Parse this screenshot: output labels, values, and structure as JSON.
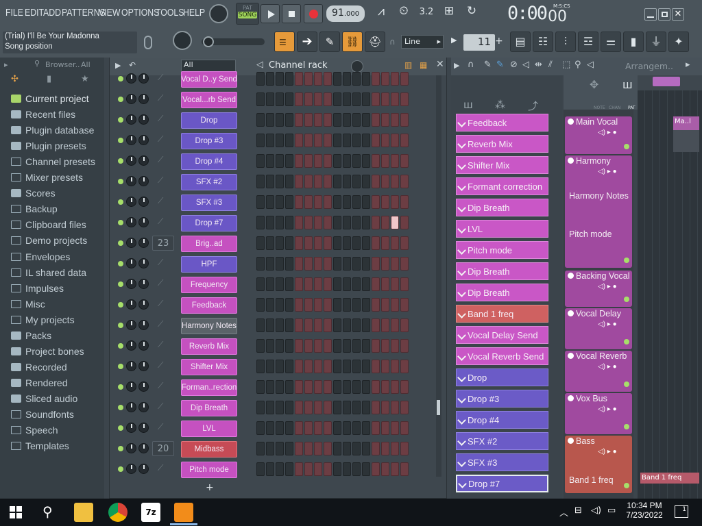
{
  "menu": [
    "FILE",
    "EDIT",
    "ADD",
    "PATTERNS",
    "VIEW",
    "OPTIONS",
    "TOOLS",
    "HELP"
  ],
  "transport": {
    "pat": "PAT",
    "song": "SONG",
    "tempo": "91",
    "tempo_dec": ".000",
    "time": "0:00",
    "time_cs": "00",
    "time_unit": "M:S:CS"
  },
  "hint": {
    "line1": "(Trial) I'll Be Your Madonna",
    "line2": "Song position"
  },
  "snap": "Line",
  "pattern": "11",
  "browser": {
    "title": "Browser..",
    "filter": "All",
    "items": [
      "Current project",
      "Recent files",
      "Plugin database",
      "Plugin presets",
      "Channel presets",
      "Mixer presets",
      "Scores",
      "Backup",
      "Clipboard files",
      "Demo projects",
      "Envelopes",
      "IL shared data",
      "Impulses",
      "Misc",
      "My projects",
      "Packs",
      "Project bones",
      "Recorded",
      "Rendered",
      "Sliced audio",
      "Soundfonts",
      "Speech",
      "Templates"
    ]
  },
  "rack": {
    "title": "Channel rack",
    "filter": "All",
    "channels": [
      {
        "name": "Vocal D..y Send",
        "color": "pink",
        "num": ""
      },
      {
        "name": "Vocal...rb Send",
        "color": "pink",
        "num": ""
      },
      {
        "name": "Drop",
        "color": "purple",
        "num": ""
      },
      {
        "name": "Drop #3",
        "color": "purple",
        "num": ""
      },
      {
        "name": "Drop #4",
        "color": "purple",
        "num": ""
      },
      {
        "name": "SFX #2",
        "color": "purple",
        "num": ""
      },
      {
        "name": "SFX #3",
        "color": "purple",
        "num": ""
      },
      {
        "name": "Drop #7",
        "color": "purple",
        "num": ""
      },
      {
        "name": "Brig..ad",
        "color": "pink",
        "num": "23"
      },
      {
        "name": "HPF",
        "color": "purple",
        "num": ""
      },
      {
        "name": "Frequency",
        "color": "pink",
        "num": ""
      },
      {
        "name": "Feedback",
        "color": "pink",
        "num": ""
      },
      {
        "name": "Harmony Notes",
        "color": "grey",
        "num": ""
      },
      {
        "name": "Reverb Mix",
        "color": "pink",
        "num": ""
      },
      {
        "name": "Shifter Mix",
        "color": "pink",
        "num": ""
      },
      {
        "name": "Forman..rection",
        "color": "pink",
        "num": ""
      },
      {
        "name": "Dip Breath",
        "color": "pink",
        "num": ""
      },
      {
        "name": "LVL",
        "color": "pink",
        "num": ""
      },
      {
        "name": "Midbass",
        "color": "red",
        "num": "20"
      },
      {
        "name": "Pitch mode",
        "color": "pink",
        "num": ""
      }
    ]
  },
  "playlist_clips": [
    {
      "name": "Feedback",
      "color": "pink"
    },
    {
      "name": "Reverb Mix",
      "color": "pink"
    },
    {
      "name": "Shifter Mix",
      "color": "pink"
    },
    {
      "name": "Formant correction",
      "color": "pink"
    },
    {
      "name": "Dip Breath",
      "color": "pink"
    },
    {
      "name": "LVL",
      "color": "pink"
    },
    {
      "name": "Pitch mode",
      "color": "pink"
    },
    {
      "name": "Dip Breath",
      "color": "pink"
    },
    {
      "name": "Dip Breath",
      "color": "pink"
    },
    {
      "name": "Band 1 freq",
      "color": "red"
    },
    {
      "name": "Vocal Delay Send",
      "color": "pink"
    },
    {
      "name": "Vocal Reverb Send",
      "color": "pink"
    },
    {
      "name": "Drop",
      "color": "purple"
    },
    {
      "name": "Drop #3",
      "color": "purple"
    },
    {
      "name": "Drop #4",
      "color": "purple"
    },
    {
      "name": "SFX #2",
      "color": "purple"
    },
    {
      "name": "SFX #3",
      "color": "purple"
    },
    {
      "name": "Drop #7",
      "color": "purple"
    }
  ],
  "arrangement": {
    "title": "Arrangem..",
    "bar": "2",
    "header_labels": [
      "NOTE",
      "CHAN",
      "PAT"
    ],
    "clip_name": "Ma..l",
    "clip_band": "Band 1 freq"
  },
  "tracks": [
    {
      "name": "Main Vocal",
      "sub": "",
      "color": "p"
    },
    {
      "name": "Harmony",
      "sub": "Harmony Notes",
      "sub2": "Pitch mode",
      "color": "p"
    },
    {
      "name": "Backing Vocal",
      "sub": "",
      "color": "p"
    },
    {
      "name": "Vocal Delay",
      "sub": "",
      "color": "p"
    },
    {
      "name": "Vocal Reverb",
      "sub": "",
      "color": "p"
    },
    {
      "name": "Vox Bus",
      "sub": "",
      "color": "p"
    },
    {
      "name": "Bass",
      "sub": "Band 1 freq",
      "color": "r"
    }
  ],
  "taskbar": {
    "time": "10:34 PM",
    "date": "7/23/2022",
    "notif": "1"
  }
}
